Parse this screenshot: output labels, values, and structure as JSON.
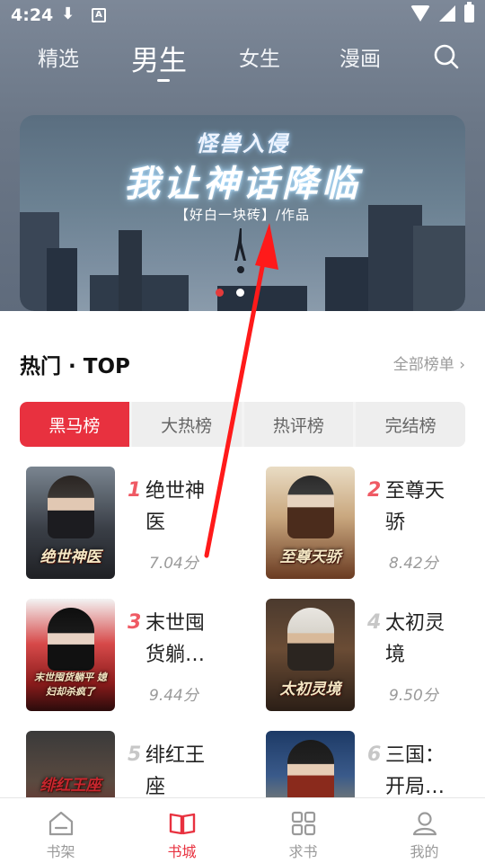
{
  "status_bar": {
    "time": "4:24",
    "download_icon": "download-icon",
    "a_icon": "A",
    "icons": [
      "wifi-icon",
      "signal-icon",
      "battery-icon"
    ]
  },
  "nav": {
    "tabs": [
      {
        "label": "精选"
      },
      {
        "label": "男生"
      },
      {
        "label": "女生"
      },
      {
        "label": "漫画"
      }
    ],
    "active_index": 1,
    "search_icon": "search-icon"
  },
  "banner": {
    "subtitle": "怪兽入侵",
    "title": "我让神话降临",
    "author": "【好白一块砖】/作品",
    "slide_count": 2,
    "active_slide": 0
  },
  "hot": {
    "title": "热门 · TOP",
    "all_link": "全部榜单",
    "tabs": [
      "黑马榜",
      "大热榜",
      "热评榜",
      "完结榜"
    ],
    "active_tab": 0,
    "books": [
      {
        "rank": "1",
        "name": "绝世神医",
        "score": "7.04分",
        "cover_text": "绝世神医"
      },
      {
        "rank": "2",
        "name": "至尊天骄",
        "score": "8.42分",
        "cover_text": "至尊天骄"
      },
      {
        "rank": "3",
        "name": "末世囤货躺…",
        "score": "9.44分",
        "cover_text": "末世囤货躺平 媳妇却杀疯了"
      },
      {
        "rank": "4",
        "name": "太初灵境",
        "score": "9.50分",
        "cover_text": "太初灵境"
      },
      {
        "rank": "5",
        "name": "绯红王座",
        "score": "",
        "cover_text": "绯红王座"
      },
      {
        "rank": "6",
        "name": "三国：开局…",
        "score": "",
        "cover_text": ""
      }
    ]
  },
  "bottom_nav": {
    "items": [
      {
        "label": "书架",
        "icon": "bookshelf-icon"
      },
      {
        "label": "书城",
        "icon": "book-open-icon"
      },
      {
        "label": "求书",
        "icon": "grid-icon"
      },
      {
        "label": "我的",
        "icon": "user-icon"
      }
    ],
    "active_index": 1
  },
  "colors": {
    "accent": "#e8313f",
    "header_bg": "#6b7787",
    "rank_top3": "#ef5a64",
    "rank_other": "#c7c7c7",
    "annotation_arrow": "#ff1a1a"
  }
}
